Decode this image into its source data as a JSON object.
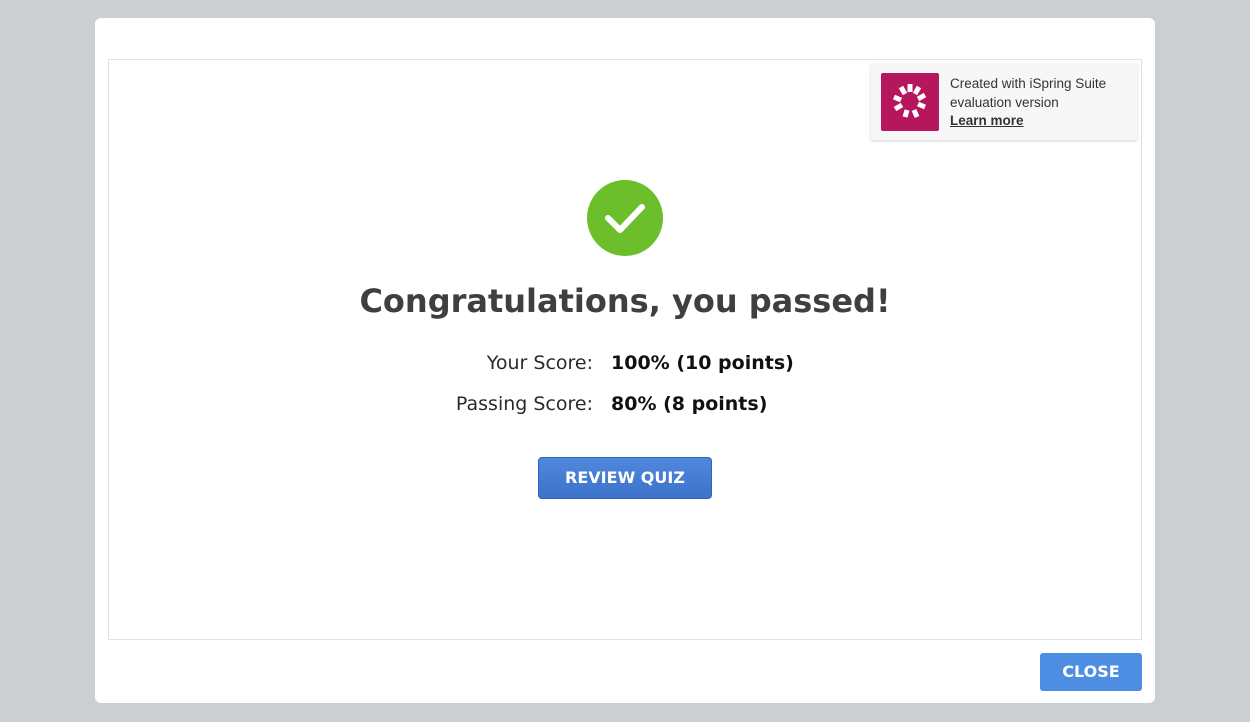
{
  "banner": {
    "line1": "Created with iSpring Suite",
    "line2": "evaluation version",
    "link": "Learn more",
    "logo_icon": "ispring-logo-icon",
    "logo_color": "#b5165c"
  },
  "result": {
    "icon": "checkmark-icon",
    "icon_color": "#6cbf2a",
    "title": "Congratulations, you passed!",
    "your_score_label": "Your Score:",
    "your_score_value": "100% (10 points)",
    "passing_score_label": "Passing Score:",
    "passing_score_value": "80% (8 points)"
  },
  "buttons": {
    "review": "REVIEW QUIZ",
    "close": "CLOSE",
    "accent": "#4d8ee3"
  }
}
